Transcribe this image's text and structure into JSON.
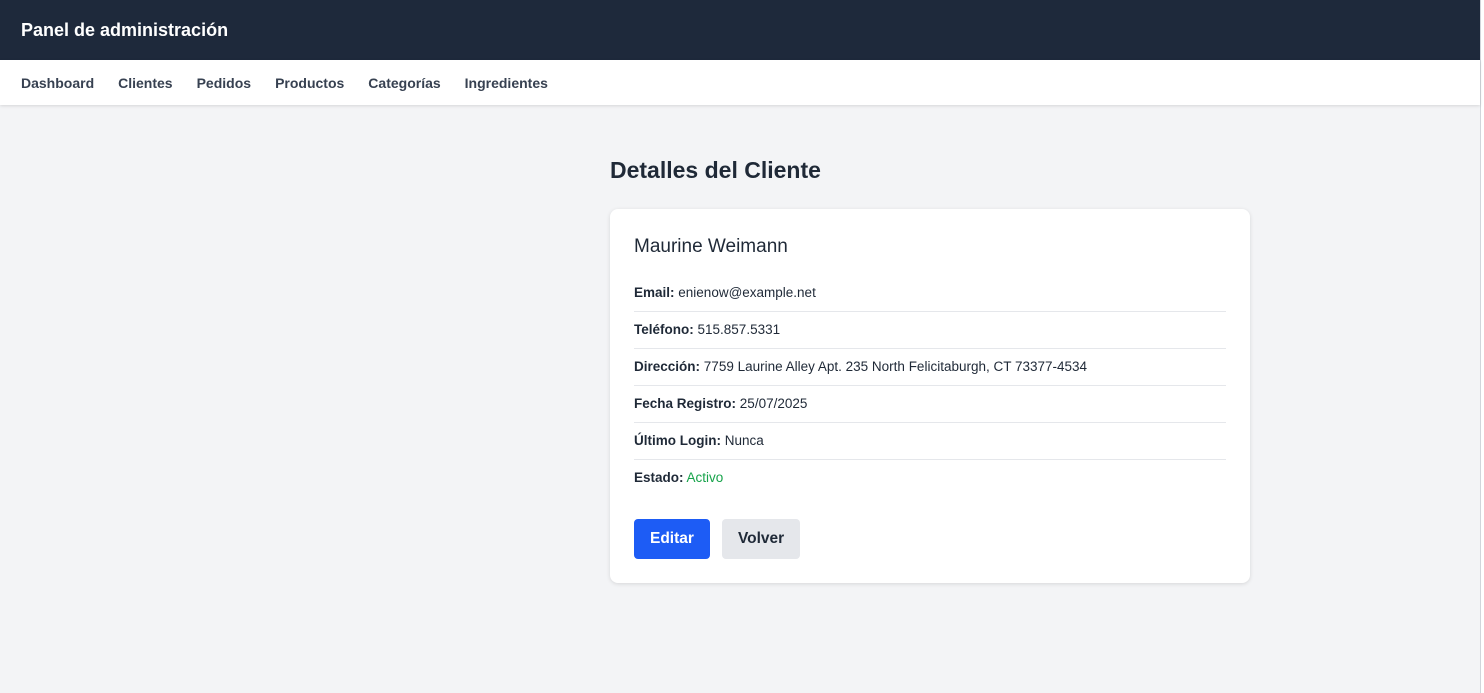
{
  "header": {
    "title": "Panel de administración"
  },
  "nav": {
    "items": [
      "Dashboard",
      "Clientes",
      "Pedidos",
      "Productos",
      "Categorías",
      "Ingredientes"
    ]
  },
  "page": {
    "title": "Detalles del Cliente"
  },
  "client": {
    "name": "Maurine Weimann",
    "fields": [
      {
        "label": "Email:",
        "value": "enienow@example.net"
      },
      {
        "label": "Teléfono:",
        "value": "515.857.5331"
      },
      {
        "label": "Dirección:",
        "value": "7759 Laurine Alley Apt. 235 North Felicitaburgh, CT 73377-4534"
      },
      {
        "label": "Fecha Registro:",
        "value": "25/07/2025"
      },
      {
        "label": "Último Login:",
        "value": "Nunca"
      },
      {
        "label": "Estado:",
        "value": "Activo"
      }
    ]
  },
  "actions": {
    "edit_label": "Editar",
    "back_label": "Volver"
  },
  "colors": {
    "topbar": "#1e293b",
    "primary_button": "#1d5cf5",
    "status_active": "#16a34a"
  }
}
